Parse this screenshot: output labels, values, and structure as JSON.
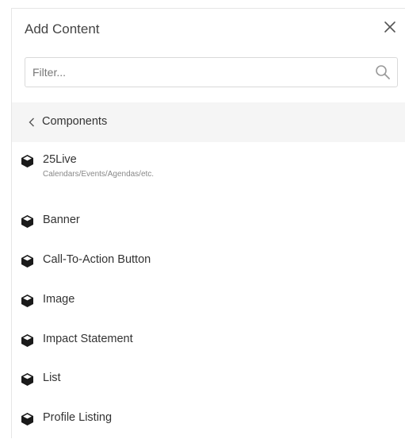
{
  "header": {
    "title": "Add Content"
  },
  "filter": {
    "placeholder": "Filter...",
    "value": ""
  },
  "breadcrumb": {
    "label": "Components"
  },
  "items": [
    {
      "name": "25Live",
      "desc": "Calendars/Events/Agendas/etc."
    },
    {
      "name": "Banner"
    },
    {
      "name": "Call-To-Action Button"
    },
    {
      "name": "Image"
    },
    {
      "name": "Impact Statement"
    },
    {
      "name": "List"
    },
    {
      "name": "Profile Listing"
    }
  ],
  "icons": {
    "close": "close-icon",
    "search": "search-icon",
    "back": "chevron-left-icon",
    "item": "cube-icon"
  }
}
